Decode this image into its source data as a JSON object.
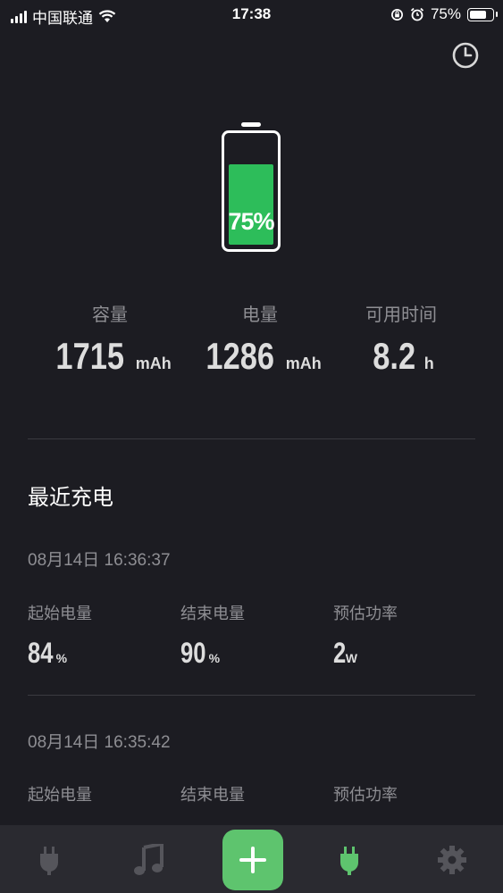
{
  "status_bar": {
    "carrier": "中国联通",
    "time": "17:38",
    "battery_percent": "75%",
    "battery_level": 0.75
  },
  "battery": {
    "percent_label": "75%",
    "level": 0.75,
    "accent_color": "#2dbd5a"
  },
  "stats": [
    {
      "label": "容量",
      "value": "1715",
      "unit": "mAh"
    },
    {
      "label": "电量",
      "value": "1286",
      "unit": "mAh"
    },
    {
      "label": "可用时间",
      "value": "8.2",
      "unit": "h"
    }
  ],
  "recent": {
    "title": "最近充电",
    "records": [
      {
        "date": "08月14日 16:36:37",
        "start_label": "起始电量",
        "start_value": "84",
        "start_unit": "%",
        "end_label": "结束电量",
        "end_value": "90",
        "end_unit": "%",
        "power_label": "预估功率",
        "power_value": "2",
        "power_unit": "W"
      },
      {
        "date": "08月14日 16:35:42",
        "start_label": "起始电量",
        "end_label": "结束电量",
        "power_label": "预估功率"
      }
    ]
  },
  "tabbar": {
    "items": [
      "plug-icon",
      "music-icon",
      "add-icon",
      "plug-active-icon",
      "gear-icon"
    ],
    "active_color": "#5ec46e"
  }
}
